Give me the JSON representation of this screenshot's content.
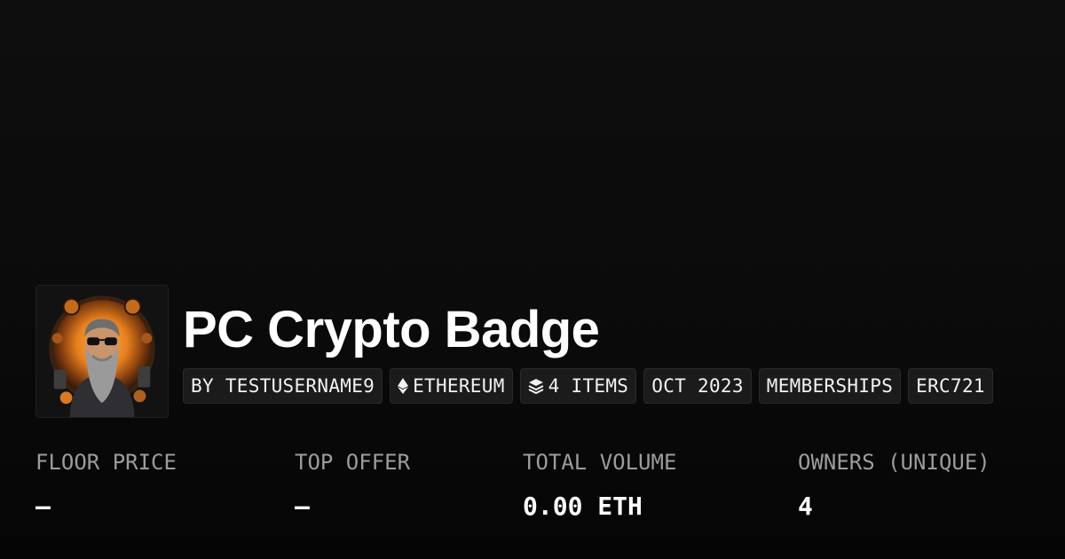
{
  "collection": {
    "name": "PC Crypto Badge",
    "avatar_icon": "bearded-man-sunglasses-portrait"
  },
  "tags": [
    {
      "label": "BY TESTUSERNAME9"
    },
    {
      "label": "ETHEREUM",
      "icon": "ethereum-icon"
    },
    {
      "label": "4 ITEMS",
      "icon": "layers-icon"
    },
    {
      "label": "OCT 2023"
    },
    {
      "label": "MEMBERSHIPS"
    },
    {
      "label": "ERC721"
    }
  ],
  "stats": [
    {
      "label": "FLOOR PRICE",
      "value": "–"
    },
    {
      "label": "TOP OFFER",
      "value": "–"
    },
    {
      "label": "TOTAL VOLUME",
      "value": "0.00 ETH"
    },
    {
      "label": "OWNERS (UNIQUE)",
      "value": "4"
    }
  ],
  "colors": {
    "background": "#0c0c0c",
    "tag_background": "#1b1b1b",
    "label_gray": "#9c9c9c",
    "accent_orange": "#e8801e"
  }
}
